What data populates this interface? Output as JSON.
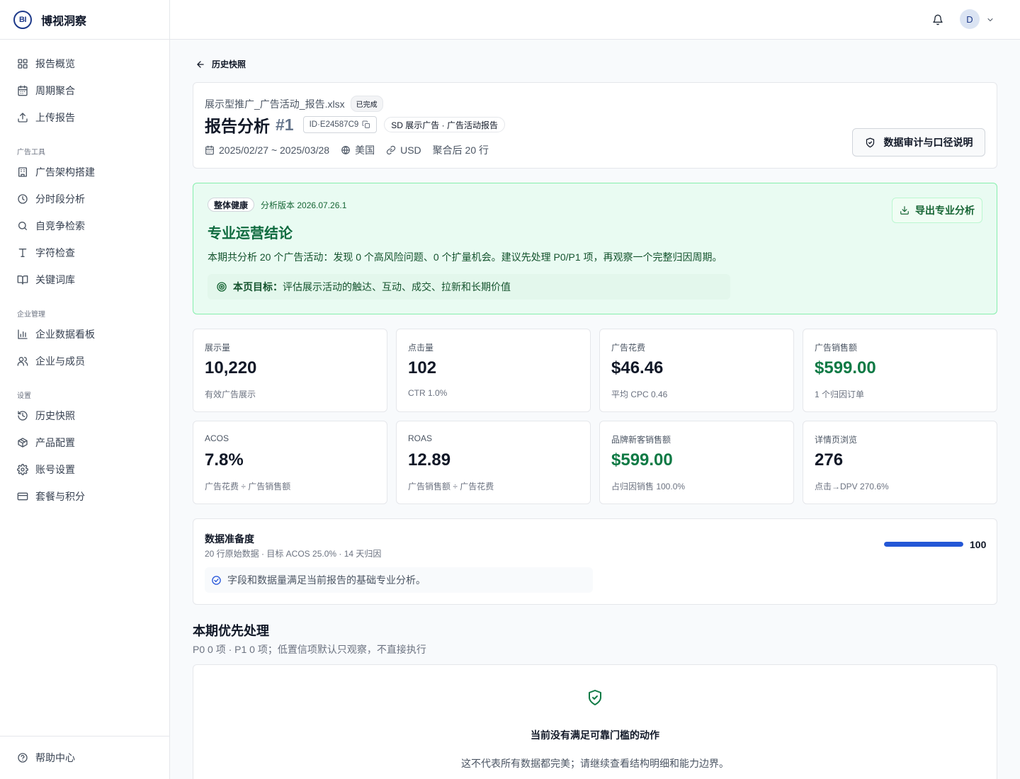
{
  "app": {
    "logo_text": "BI",
    "name": "博视洞察"
  },
  "sidebar": {
    "items_main": [
      {
        "label": "报告概览",
        "icon": "grid-icon"
      },
      {
        "label": "周期聚合",
        "icon": "calendar-icon"
      },
      {
        "label": "上传报告",
        "icon": "upload-icon"
      }
    ],
    "section_ads": "广告工具",
    "items_ads": [
      {
        "label": "广告架构搭建",
        "icon": "building-icon"
      },
      {
        "label": "分时段分析",
        "icon": "clock-icon"
      },
      {
        "label": "自竞争检索",
        "icon": "search-icon"
      },
      {
        "label": "字符检查",
        "icon": "type-icon"
      },
      {
        "label": "关键词库",
        "icon": "book-icon"
      }
    ],
    "section_enterprise": "企业管理",
    "items_enterprise": [
      {
        "label": "企业数据看板",
        "icon": "bar-chart-icon"
      },
      {
        "label": "企业与成员",
        "icon": "users-icon"
      }
    ],
    "section_settings": "设置",
    "items_settings": [
      {
        "label": "历史快照",
        "icon": "history-icon"
      },
      {
        "label": "产品配置",
        "icon": "package-icon"
      },
      {
        "label": "账号设置",
        "icon": "gear-icon"
      },
      {
        "label": "套餐与积分",
        "icon": "credit-card-icon"
      }
    ],
    "help": {
      "label": "帮助中心",
      "icon": "help-circle-icon"
    }
  },
  "topbar": {
    "avatar_initial": "D"
  },
  "back": {
    "label": "历史快照"
  },
  "report": {
    "file_name": "展示型推广_广告活动_报告.xlsx",
    "status": "已完成",
    "title": "报告分析",
    "number": "#1",
    "id": "ID·E24587C9",
    "type": "SD 展示广告 · 广告活动报告",
    "date_range": "2025/02/27 ~ 2025/03/28",
    "country": "美国",
    "currency": "USD",
    "rows": "聚合后 20 行",
    "audit_button": "数据审计与口径说明"
  },
  "health": {
    "badge": "整体健康",
    "version": "分析版本 2026.07.26.1",
    "title": "专业运营结论",
    "summary": "本期共分析 20 个广告活动：发现 0 个高风险问题、0 个扩量机会。建议先处理 P0/P1 项，再观察一个完整归因周期。",
    "goal_label": "本页目标：",
    "goal_text": "评估展示活动的触达、互动、成交、拉新和长期价值",
    "export_button": "导出专业分析"
  },
  "kpis": [
    {
      "label": "展示量",
      "value": "10,220",
      "sub": "有效广告展示",
      "accent": false
    },
    {
      "label": "点击量",
      "value": "102",
      "sub": "CTR 1.0%",
      "accent": false
    },
    {
      "label": "广告花费",
      "value": "$46.46",
      "sub": "平均 CPC 0.46",
      "accent": false
    },
    {
      "label": "广告销售额",
      "value": "$599.00",
      "sub": "1 个归因订单",
      "accent": true
    },
    {
      "label": "ACOS",
      "value": "7.8%",
      "sub": "广告花费 ÷ 广告销售额",
      "accent": false
    },
    {
      "label": "ROAS",
      "value": "12.89",
      "sub": "广告销售额 ÷ 广告花费",
      "accent": false
    },
    {
      "label": "品牌新客销售额",
      "value": "$599.00",
      "sub": "占归因销售 100.0%",
      "accent": true
    },
    {
      "label": "详情页浏览",
      "value": "276",
      "sub": "点击→DPV 270.6%",
      "accent": false
    }
  ],
  "readiness": {
    "title": "数据准备度",
    "subtitle": "20 行原始数据 · 目标 ACOS 25.0% · 14 天归因",
    "score": 100,
    "score_label": "100",
    "note": "字段和数据量满足当前报告的基础专业分析。"
  },
  "priority": {
    "title": "本期优先处理",
    "subtitle": "P0 0 项 · P1 0 项；低置信项默认只观察，不直接执行",
    "empty_title": "当前没有满足可靠门槛的动作",
    "empty_sub": "这不代表所有数据都完美；请继续查看结构明细和能力边界。"
  },
  "colors": {
    "brand": "#1e3a8a",
    "success": "#0f7a45",
    "progress": "#2457d6",
    "health_bg": "#e9fbf2"
  }
}
